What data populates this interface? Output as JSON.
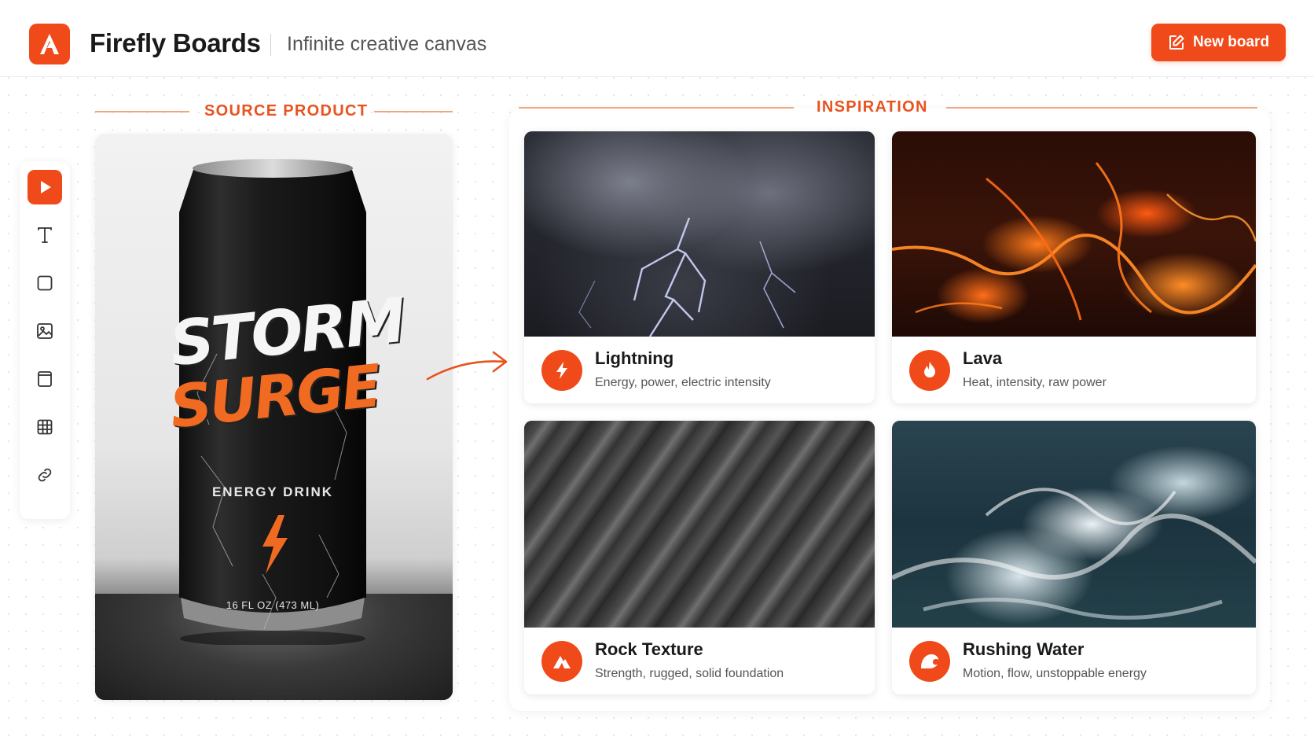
{
  "header": {
    "logo_letter": "A",
    "app_title": "Firefly Boards",
    "subtitle": "Infinite creative canvas",
    "new_board_label": "New board"
  },
  "toolbar": {
    "tools": [
      {
        "name": "play",
        "icon": "play-icon",
        "active": true
      },
      {
        "name": "text",
        "icon": "text-icon",
        "active": false
      },
      {
        "name": "shape",
        "icon": "square-icon",
        "active": false
      },
      {
        "name": "image",
        "icon": "image-icon",
        "active": false
      },
      {
        "name": "frame",
        "icon": "frame-icon",
        "active": false
      },
      {
        "name": "table",
        "icon": "table-icon",
        "active": false
      },
      {
        "name": "link",
        "icon": "link-icon",
        "active": false
      }
    ]
  },
  "source": {
    "label": "SOURCE PRODUCT",
    "can": {
      "line1": "STORM",
      "line2": "SURGE",
      "tagline": "ENERGY DRINK",
      "volume": "16 FL OZ (473 ML)"
    }
  },
  "inspiration": {
    "label": "INSPIRATION",
    "cards": [
      {
        "title": "Lightning",
        "description": "Energy, power, electric intensity",
        "icon": "bolt-icon"
      },
      {
        "title": "Lava",
        "description": "Heat, intensity, raw power",
        "icon": "flame-icon"
      },
      {
        "title": "Rock Texture",
        "description": "Strength, rugged, solid foundation",
        "icon": "mountain-icon"
      },
      {
        "title": "Rushing Water",
        "description": "Motion, flow, unstoppable energy",
        "icon": "wave-icon"
      }
    ]
  },
  "colors": {
    "accent": "#f04a1a",
    "label_orange": "#e8531f"
  }
}
